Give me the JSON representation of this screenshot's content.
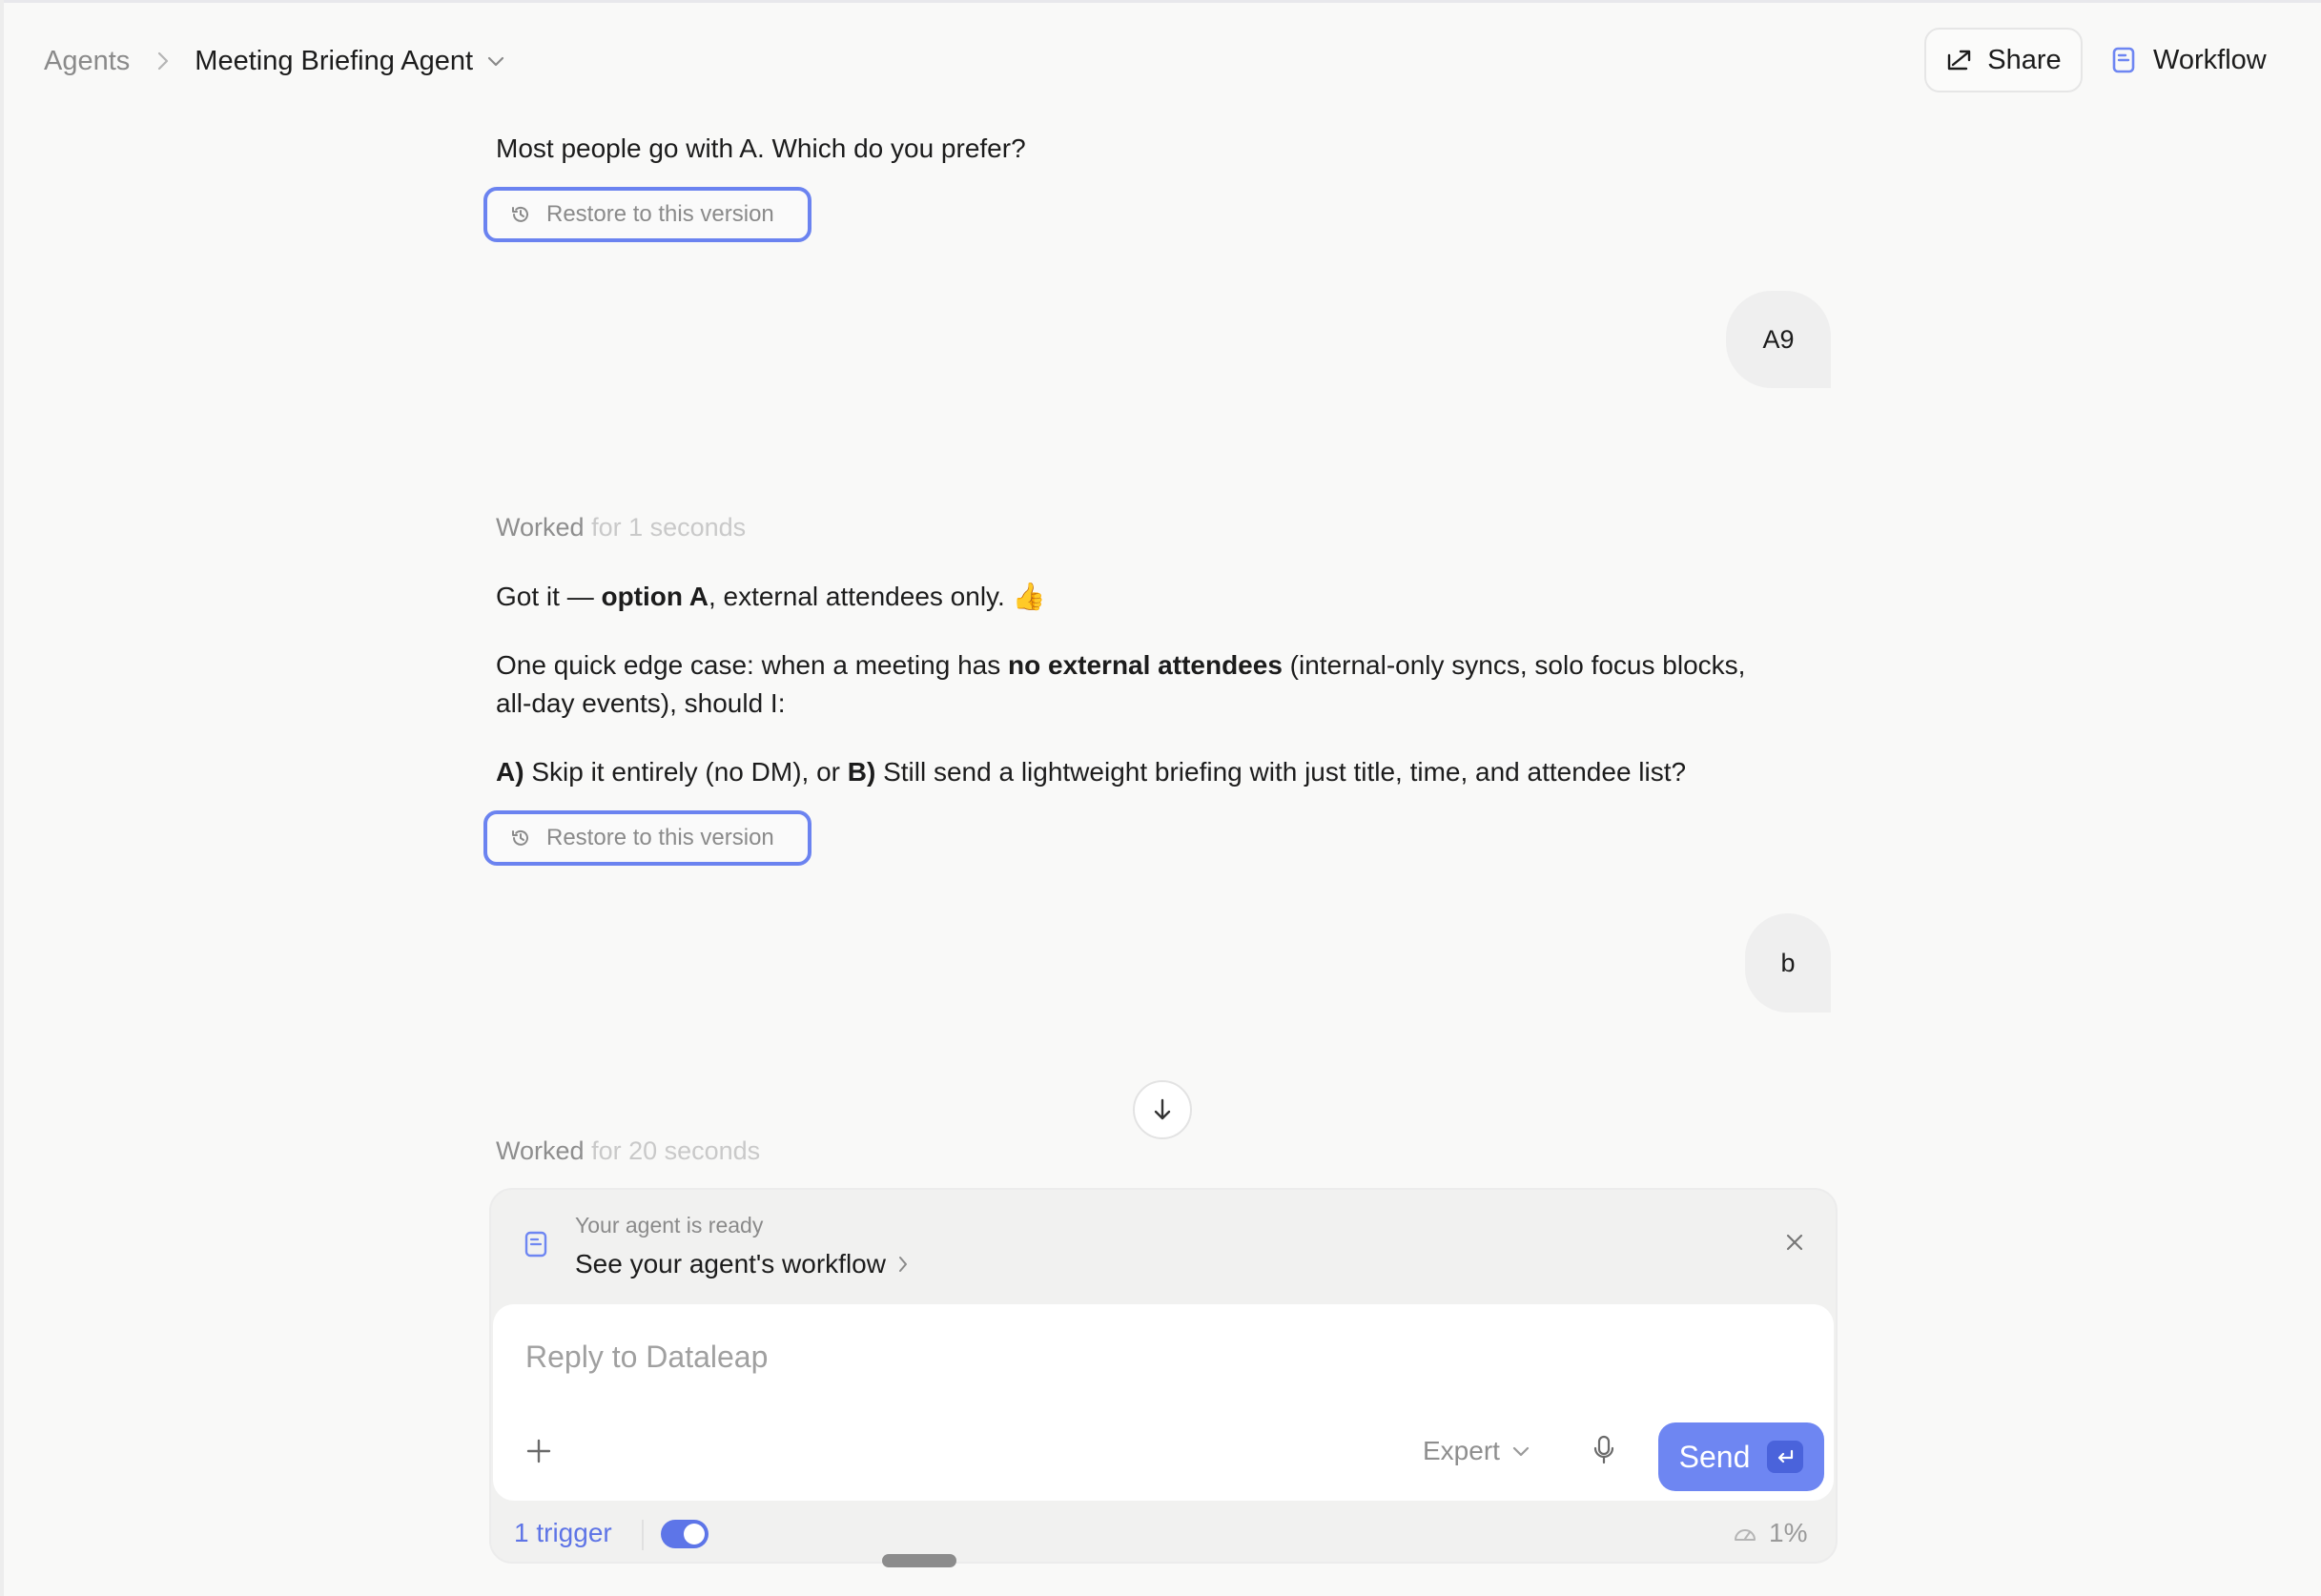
{
  "header": {
    "breadcrumb_root": "Agents",
    "breadcrumb_current": "Meeting Briefing Agent",
    "share_label": "Share",
    "workflow_label": "Workflow"
  },
  "messages": [
    {
      "role": "agent",
      "text": "Most people go with A. Which do you prefer?",
      "restore_label": "Restore to this version"
    },
    {
      "role": "user",
      "text": "A9"
    },
    {
      "role": "agent",
      "worked_prefix": "Worked",
      "worked_suffix": "for 1 seconds",
      "p1_a": "Got it — ",
      "p1_bold": "option A",
      "p1_b": ", external attendees only. 👍",
      "p2_a": "One quick edge case: when a meeting has ",
      "p2_bold": "no external attendees",
      "p2_b": " (internal-only syncs, solo focus blocks,",
      "p2_c": "all-day events), should I:",
      "p3_a_bold": "A)",
      "p3_a": " Skip it entirely (no DM), or ",
      "p3_b_bold": "B)",
      "p3_b": " Still send a lightweight briefing with just title, time, and attendee list?",
      "restore_label": "Restore to this version"
    },
    {
      "role": "user",
      "text": "b"
    },
    {
      "role": "agent",
      "worked_prefix": "Worked",
      "worked_suffix": "for 20 seconds"
    }
  ],
  "composer": {
    "ready_subtitle": "Your agent is ready",
    "ready_title": "See your agent's workflow",
    "input_placeholder": "Reply to Dataleap",
    "input_value": "",
    "mode_label": "Expert",
    "send_label": "Send",
    "trigger_label": "1 trigger",
    "trigger_enabled": true,
    "usage_label": "1%"
  },
  "colors": {
    "accent": "#6e86f2",
    "background": "#f9f9f8",
    "bubble": "#efefef",
    "restore_border": "#6b83f0"
  },
  "icons": [
    "chevron-right-icon",
    "chevron-down-icon",
    "share-icon",
    "workflow-doc-icon",
    "history-icon",
    "arrow-down-icon",
    "close-icon",
    "plus-icon",
    "microphone-icon",
    "enter-key-icon",
    "gauge-icon"
  ]
}
